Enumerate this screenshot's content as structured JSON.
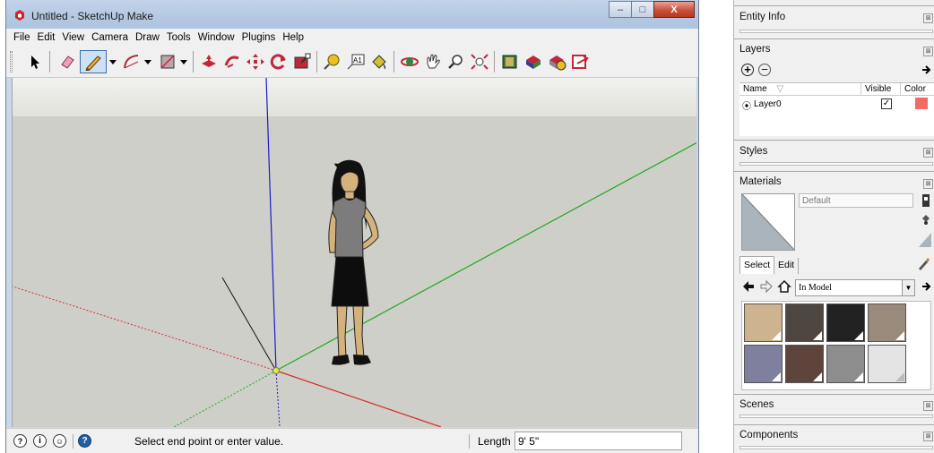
{
  "window": {
    "title": "Untitled - SketchUp Make",
    "minimize_glyph": "–",
    "maximize_glyph": "□",
    "close_glyph": "X"
  },
  "menu": [
    "File",
    "Edit",
    "View",
    "Camera",
    "Draw",
    "Tools",
    "Window",
    "Plugins",
    "Help"
  ],
  "toolbar": {
    "icons": [
      "select-icon",
      "eraser-icon",
      "line-pencil-icon",
      "arc-icon",
      "rectangle-icon",
      "push-pull-icon",
      "follow-me-icon",
      "move-icon",
      "rotate-icon",
      "scale-icon",
      "tape-measure-icon",
      "text-icon",
      "paint-bucket-icon",
      "orbit-icon",
      "pan-icon",
      "zoom-icon",
      "zoom-extents-icon",
      "model-info-icon",
      "components-icon",
      "get-models-icon",
      "share-model-icon"
    ],
    "active": "line-pencil-icon",
    "text_tool_glyph": "A1"
  },
  "status": {
    "message": "Select end point or enter value.",
    "length_label": "Length",
    "length_value": "9' 5\""
  },
  "tray": {
    "entity_info": {
      "title": "Entity Info"
    },
    "layers": {
      "title": "Layers",
      "columns": [
        "Name",
        "Visible",
        "Color"
      ],
      "rows": [
        {
          "name": "Layer0",
          "visible": true,
          "color": "#f26a64"
        }
      ]
    },
    "styles": {
      "title": "Styles"
    },
    "materials": {
      "title": "Materials",
      "name_value": "Default",
      "tabs": [
        "Select",
        "Edit"
      ],
      "collection": "In Model",
      "swatches": [
        "#cdb48e",
        "#4e4641",
        "#222222",
        "#9a8a7c",
        "#7f7f9e",
        "#5e453b",
        "#8d8d8d",
        "#e4e4e4"
      ]
    },
    "scenes": {
      "title": "Scenes"
    },
    "components": {
      "title": "Components"
    }
  },
  "colors": {
    "axis_blue": "#1a1acc",
    "axis_red": "#d42b2b",
    "axis_green": "#1fa81f",
    "sky": "#eeeeea",
    "ground": "#cfcfc9"
  }
}
